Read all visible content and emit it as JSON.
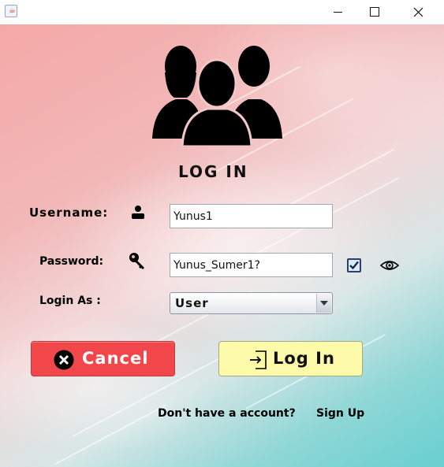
{
  "window": {
    "icon": "java-cup-icon",
    "controls": [
      "minimize-icon",
      "maximize-icon",
      "close-icon"
    ]
  },
  "form": {
    "title": "LOG IN",
    "username_label": "Username:",
    "username_value": "Yunus1",
    "password_label": "Password:",
    "password_value": "Yunus_Sumer1?",
    "show_password_checked": true,
    "login_as_label": "Login As :",
    "login_as_value": "User"
  },
  "buttons": {
    "cancel_label": "Cancel",
    "login_label": "Log In"
  },
  "footer": {
    "no_account_text": "Don't have a account?",
    "signup_label": "Sign Up"
  },
  "colors": {
    "cancel_bg": "#f1474a",
    "login_bg": "#fdfbaa",
    "bg_top": "#f4a9a8",
    "bg_bottom": "#68cfd0"
  }
}
